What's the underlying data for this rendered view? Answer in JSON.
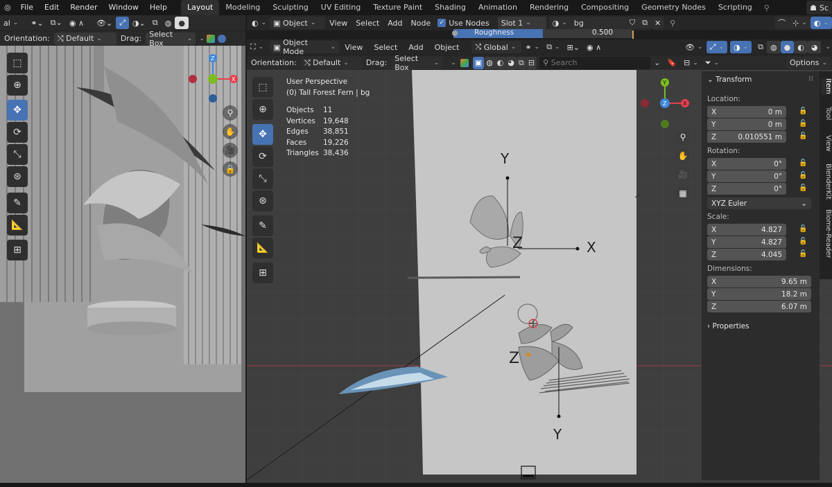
{
  "topbar": {
    "menus": [
      "File",
      "Edit",
      "Render",
      "Window",
      "Help"
    ],
    "workspaces": [
      "Layout",
      "Modeling",
      "Sculpting",
      "UV Editing",
      "Texture Paint",
      "Shading",
      "Animation",
      "Rendering",
      "Compositing",
      "Geometry Nodes",
      "Scripting"
    ],
    "active_workspace": "Layout",
    "scene_label": "Sc"
  },
  "left_viewport": {
    "header": {
      "mode_fragment": "al"
    },
    "toolbar_row": {
      "orientation_label": "Orientation:",
      "orientation_value": "Default",
      "drag_label": "Drag:",
      "drag_value": "Select Box"
    }
  },
  "node_editor": {
    "header": {
      "editor_type": "Object",
      "menus": [
        "View",
        "Select",
        "Add",
        "Node"
      ],
      "use_nodes_label": "Use Nodes",
      "use_nodes_checked": true,
      "slot": "Slot 1",
      "material": "bg"
    },
    "peek": {
      "field_label": "Roughness",
      "field_value": "0.500"
    }
  },
  "main_viewport": {
    "header": {
      "mode": "Object Mode",
      "menus": [
        "View",
        "Select",
        "Add",
        "Object"
      ],
      "transform_orientation": "Global"
    },
    "toolbar_row": {
      "orientation_label": "Orientation:",
      "orientation_value": "Default",
      "drag_label": "Drag:",
      "drag_value": "Select Box",
      "search_placeholder": "Search",
      "options_label": "Options"
    },
    "overlay": {
      "view_name": "User Perspective",
      "object_line": "(0) Tall Forest Fern | bg",
      "stats": [
        {
          "label": "Objects",
          "value": "11"
        },
        {
          "label": "Vertices",
          "value": "19,648"
        },
        {
          "label": "Edges",
          "value": "38,851"
        },
        {
          "label": "Faces",
          "value": "19,226"
        },
        {
          "label": "Triangles",
          "value": "38,436"
        }
      ]
    },
    "gizmo_axis_labels": {
      "y_top": "Y",
      "x_right": "X",
      "z_mid": "Z",
      "z_low": "Z",
      "y_bottom": "Y"
    }
  },
  "n_panel": {
    "section_title": "Transform",
    "location_label": "Location:",
    "location": [
      {
        "axis": "X",
        "value": "0 m"
      },
      {
        "axis": "Y",
        "value": "0 m"
      },
      {
        "axis": "Z",
        "value": "0.010551 m"
      }
    ],
    "rotation_label": "Rotation:",
    "rotation": [
      {
        "axis": "X",
        "value": "0°"
      },
      {
        "axis": "Y",
        "value": "0°"
      },
      {
        "axis": "Z",
        "value": "0°"
      }
    ],
    "rotation_mode": "XYZ Euler",
    "scale_label": "Scale:",
    "scale": [
      {
        "axis": "X",
        "value": "4.827"
      },
      {
        "axis": "Y",
        "value": "4.827"
      },
      {
        "axis": "Z",
        "value": "4.045"
      }
    ],
    "dimensions_label": "Dimensions:",
    "dimensions": [
      {
        "axis": "X",
        "value": "9.65 m"
      },
      {
        "axis": "Y",
        "value": "18.2 m"
      },
      {
        "axis": "Z",
        "value": "6.07 m"
      }
    ],
    "properties_label": "Properties",
    "vertical_tabs": [
      "Item",
      "Tool",
      "View",
      "BlenderKit",
      "Biome-Reader"
    ]
  },
  "colors": {
    "accent": "#4772b3",
    "axis_x": "#e6404e",
    "axis_y": "#7cbc22",
    "axis_z": "#3e88dd"
  }
}
